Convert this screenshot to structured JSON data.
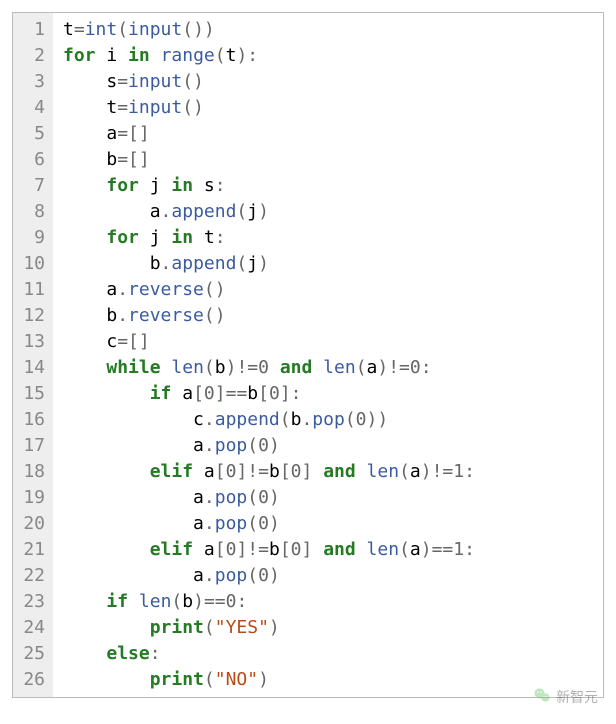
{
  "lines": [
    {
      "n": "1",
      "indent": 0,
      "tokens": [
        [
          "",
          "t"
        ],
        [
          "op",
          "="
        ],
        [
          "fn",
          "int"
        ],
        [
          "op",
          "("
        ],
        [
          "fn",
          "input"
        ],
        [
          "op",
          "()"
        ],
        [
          "op",
          ")"
        ]
      ]
    },
    {
      "n": "2",
      "indent": 0,
      "tokens": [
        [
          "kw",
          "for"
        ],
        [
          "",
          " i "
        ],
        [
          "kw",
          "in"
        ],
        [
          "",
          " "
        ],
        [
          "fn",
          "range"
        ],
        [
          "op",
          "("
        ],
        [
          "",
          "t"
        ],
        [
          "op",
          "):"
        ]
      ]
    },
    {
      "n": "3",
      "indent": 1,
      "tokens": [
        [
          "",
          "s"
        ],
        [
          "op",
          "="
        ],
        [
          "fn",
          "input"
        ],
        [
          "op",
          "()"
        ]
      ]
    },
    {
      "n": "4",
      "indent": 1,
      "tokens": [
        [
          "",
          "t"
        ],
        [
          "op",
          "="
        ],
        [
          "fn",
          "input"
        ],
        [
          "op",
          "()"
        ]
      ]
    },
    {
      "n": "5",
      "indent": 1,
      "tokens": [
        [
          "",
          "a"
        ],
        [
          "op",
          "="
        ],
        [
          "op",
          "[]"
        ]
      ]
    },
    {
      "n": "6",
      "indent": 1,
      "tokens": [
        [
          "",
          "b"
        ],
        [
          "op",
          "="
        ],
        [
          "op",
          "[]"
        ]
      ]
    },
    {
      "n": "7",
      "indent": 1,
      "tokens": [
        [
          "kw",
          "for"
        ],
        [
          "",
          " j "
        ],
        [
          "kw",
          "in"
        ],
        [
          "",
          " s"
        ],
        [
          "op",
          ":"
        ]
      ]
    },
    {
      "n": "8",
      "indent": 2,
      "tokens": [
        [
          "",
          "a"
        ],
        [
          "op",
          "."
        ],
        [
          "fn",
          "append"
        ],
        [
          "op",
          "("
        ],
        [
          "",
          "j"
        ],
        [
          "op",
          ")"
        ]
      ]
    },
    {
      "n": "9",
      "indent": 1,
      "tokens": [
        [
          "kw",
          "for"
        ],
        [
          "",
          " j "
        ],
        [
          "kw",
          "in"
        ],
        [
          "",
          " t"
        ],
        [
          "op",
          ":"
        ]
      ]
    },
    {
      "n": "10",
      "indent": 2,
      "tokens": [
        [
          "",
          "b"
        ],
        [
          "op",
          "."
        ],
        [
          "fn",
          "append"
        ],
        [
          "op",
          "("
        ],
        [
          "",
          "j"
        ],
        [
          "op",
          ")"
        ]
      ]
    },
    {
      "n": "11",
      "indent": 1,
      "tokens": [
        [
          "",
          "a"
        ],
        [
          "op",
          "."
        ],
        [
          "fn",
          "reverse"
        ],
        [
          "op",
          "()"
        ]
      ]
    },
    {
      "n": "12",
      "indent": 1,
      "tokens": [
        [
          "",
          "b"
        ],
        [
          "op",
          "."
        ],
        [
          "fn",
          "reverse"
        ],
        [
          "op",
          "()"
        ]
      ]
    },
    {
      "n": "13",
      "indent": 1,
      "tokens": [
        [
          "",
          "c"
        ],
        [
          "op",
          "="
        ],
        [
          "op",
          "[]"
        ]
      ]
    },
    {
      "n": "14",
      "indent": 1,
      "tokens": [
        [
          "kw",
          "while"
        ],
        [
          "",
          " "
        ],
        [
          "fn",
          "len"
        ],
        [
          "op",
          "("
        ],
        [
          "",
          "b"
        ],
        [
          "op",
          ")"
        ],
        [
          "op",
          "!="
        ],
        [
          "num",
          "0"
        ],
        [
          "",
          " "
        ],
        [
          "kw",
          "and"
        ],
        [
          "",
          " "
        ],
        [
          "fn",
          "len"
        ],
        [
          "op",
          "("
        ],
        [
          "",
          "a"
        ],
        [
          "op",
          ")"
        ],
        [
          "op",
          "!="
        ],
        [
          "num",
          "0"
        ],
        [
          "op",
          ":"
        ]
      ]
    },
    {
      "n": "15",
      "indent": 2,
      "tokens": [
        [
          "kw",
          "if"
        ],
        [
          "",
          " a"
        ],
        [
          "op",
          "["
        ],
        [
          "num",
          "0"
        ],
        [
          "op",
          "]"
        ],
        [
          "op",
          "=="
        ],
        [
          "",
          "b"
        ],
        [
          "op",
          "["
        ],
        [
          "num",
          "0"
        ],
        [
          "op",
          "]:"
        ]
      ]
    },
    {
      "n": "16",
      "indent": 3,
      "tokens": [
        [
          "",
          "c"
        ],
        [
          "op",
          "."
        ],
        [
          "fn",
          "append"
        ],
        [
          "op",
          "("
        ],
        [
          "",
          "b"
        ],
        [
          "op",
          "."
        ],
        [
          "fn",
          "pop"
        ],
        [
          "op",
          "("
        ],
        [
          "num",
          "0"
        ],
        [
          "op",
          "))"
        ]
      ]
    },
    {
      "n": "17",
      "indent": 3,
      "tokens": [
        [
          "",
          "a"
        ],
        [
          "op",
          "."
        ],
        [
          "fn",
          "pop"
        ],
        [
          "op",
          "("
        ],
        [
          "num",
          "0"
        ],
        [
          "op",
          ")"
        ]
      ]
    },
    {
      "n": "18",
      "indent": 2,
      "tokens": [
        [
          "kw",
          "elif"
        ],
        [
          "",
          " a"
        ],
        [
          "op",
          "["
        ],
        [
          "num",
          "0"
        ],
        [
          "op",
          "]"
        ],
        [
          "op",
          "!="
        ],
        [
          "",
          "b"
        ],
        [
          "op",
          "["
        ],
        [
          "num",
          "0"
        ],
        [
          "op",
          "]"
        ],
        [
          "",
          " "
        ],
        [
          "kw",
          "and"
        ],
        [
          "",
          " "
        ],
        [
          "fn",
          "len"
        ],
        [
          "op",
          "("
        ],
        [
          "",
          "a"
        ],
        [
          "op",
          ")"
        ],
        [
          "op",
          "!="
        ],
        [
          "num",
          "1"
        ],
        [
          "op",
          ":"
        ]
      ]
    },
    {
      "n": "19",
      "indent": 3,
      "tokens": [
        [
          "",
          "a"
        ],
        [
          "op",
          "."
        ],
        [
          "fn",
          "pop"
        ],
        [
          "op",
          "("
        ],
        [
          "num",
          "0"
        ],
        [
          "op",
          ")"
        ]
      ]
    },
    {
      "n": "20",
      "indent": 3,
      "tokens": [
        [
          "",
          "a"
        ],
        [
          "op",
          "."
        ],
        [
          "fn",
          "pop"
        ],
        [
          "op",
          "("
        ],
        [
          "num",
          "0"
        ],
        [
          "op",
          ")"
        ]
      ]
    },
    {
      "n": "21",
      "indent": 2,
      "tokens": [
        [
          "kw",
          "elif"
        ],
        [
          "",
          " a"
        ],
        [
          "op",
          "["
        ],
        [
          "num",
          "0"
        ],
        [
          "op",
          "]"
        ],
        [
          "op",
          "!="
        ],
        [
          "",
          "b"
        ],
        [
          "op",
          "["
        ],
        [
          "num",
          "0"
        ],
        [
          "op",
          "]"
        ],
        [
          "",
          " "
        ],
        [
          "kw",
          "and"
        ],
        [
          "",
          " "
        ],
        [
          "fn",
          "len"
        ],
        [
          "op",
          "("
        ],
        [
          "",
          "a"
        ],
        [
          "op",
          ")"
        ],
        [
          "op",
          "=="
        ],
        [
          "num",
          "1"
        ],
        [
          "op",
          ":"
        ]
      ]
    },
    {
      "n": "22",
      "indent": 3,
      "tokens": [
        [
          "",
          "a"
        ],
        [
          "op",
          "."
        ],
        [
          "fn",
          "pop"
        ],
        [
          "op",
          "("
        ],
        [
          "num",
          "0"
        ],
        [
          "op",
          ")"
        ]
      ]
    },
    {
      "n": "23",
      "indent": 1,
      "tokens": [
        [
          "kw",
          "if"
        ],
        [
          "",
          " "
        ],
        [
          "fn",
          "len"
        ],
        [
          "op",
          "("
        ],
        [
          "",
          "b"
        ],
        [
          "op",
          ")"
        ],
        [
          "op",
          "=="
        ],
        [
          "num",
          "0"
        ],
        [
          "op",
          ":"
        ]
      ]
    },
    {
      "n": "24",
      "indent": 2,
      "tokens": [
        [
          "kw",
          "print"
        ],
        [
          "op",
          "("
        ],
        [
          "str",
          "\"YES\""
        ],
        [
          "op",
          ")"
        ]
      ]
    },
    {
      "n": "25",
      "indent": 1,
      "tokens": [
        [
          "kw",
          "else"
        ],
        [
          "op",
          ":"
        ]
      ]
    },
    {
      "n": "26",
      "indent": 2,
      "tokens": [
        [
          "kw",
          "print"
        ],
        [
          "op",
          "("
        ],
        [
          "str",
          "\"NO\""
        ],
        [
          "op",
          ")"
        ]
      ]
    }
  ],
  "watermark": "新智元",
  "indent_unit": "    "
}
